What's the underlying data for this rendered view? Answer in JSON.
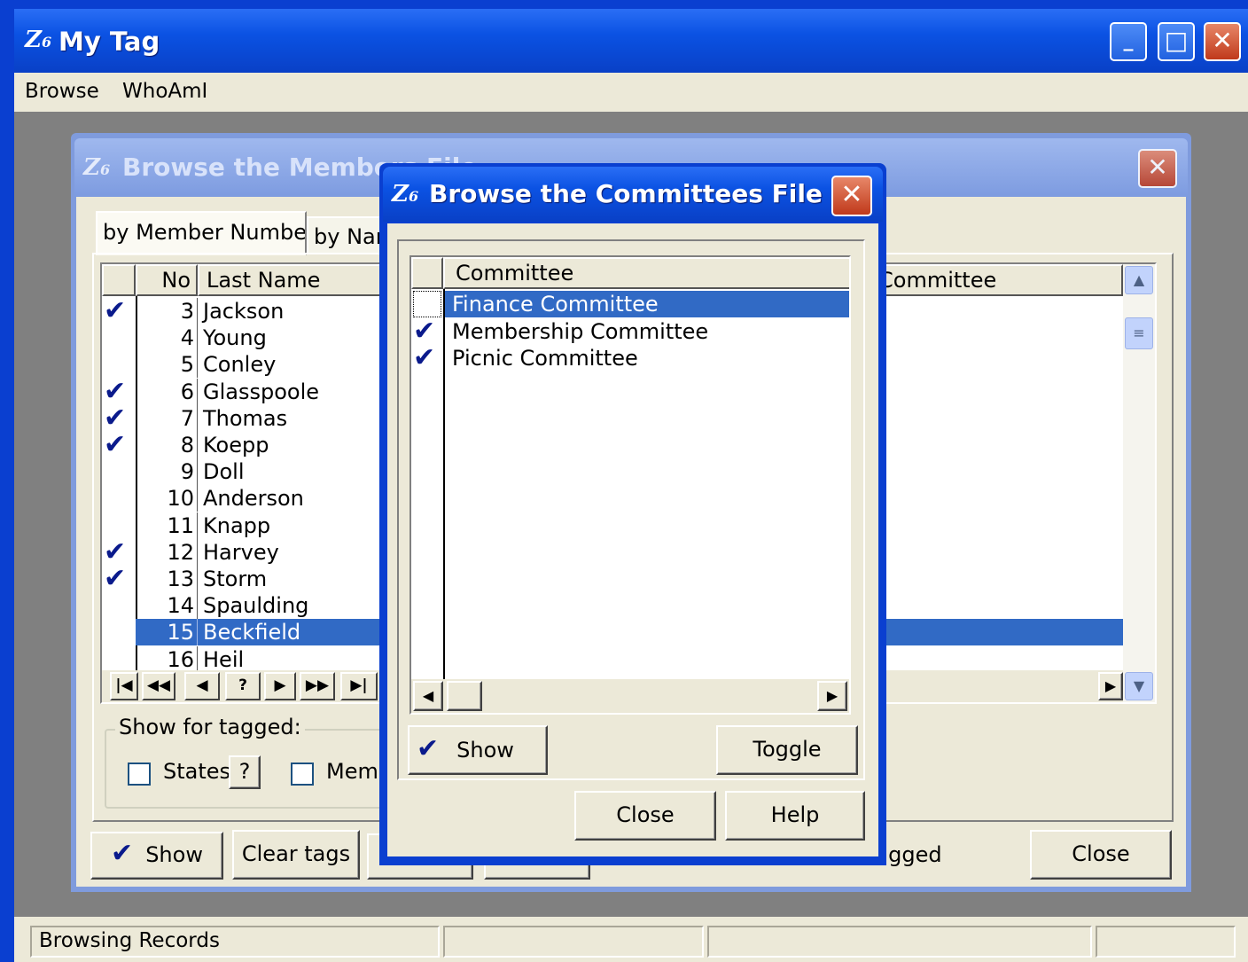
{
  "main_window": {
    "title": "My Tag",
    "logo": "Z",
    "logo_sub": "6",
    "controls": {
      "minimize": "_",
      "maximize": "□",
      "close": "✕"
    },
    "menu": [
      "Browse",
      "WhoAmI"
    ]
  },
  "members_dialog": {
    "title": "Browse the Members File",
    "close_glyph": "✕",
    "tabs": [
      "by Member Number",
      "by Name"
    ],
    "columns": {
      "no": "No",
      "last_name": "Last Name",
      "committee": "Committee"
    },
    "rows": [
      {
        "no": "3",
        "last_name": "Jackson",
        "tagged": true
      },
      {
        "no": "4",
        "last_name": "Young",
        "tagged": false
      },
      {
        "no": "5",
        "last_name": "Conley",
        "tagged": false
      },
      {
        "no": "6",
        "last_name": "Glasspoole",
        "tagged": true
      },
      {
        "no": "7",
        "last_name": "Thomas",
        "tagged": true
      },
      {
        "no": "8",
        "last_name": "Koepp",
        "tagged": true
      },
      {
        "no": "9",
        "last_name": "Doll",
        "tagged": false
      },
      {
        "no": "10",
        "last_name": "Anderson",
        "tagged": false
      },
      {
        "no": "11",
        "last_name": "Knapp",
        "tagged": false
      },
      {
        "no": "12",
        "last_name": "Harvey",
        "tagged": true
      },
      {
        "no": "13",
        "last_name": "Storm",
        "tagged": true
      },
      {
        "no": "14",
        "last_name": "Spaulding",
        "tagged": false
      },
      {
        "no": "15",
        "last_name": "Beckfield",
        "tagged": false,
        "selected": true
      },
      {
        "no": "16",
        "last_name": "Heil",
        "tagged": false
      }
    ],
    "nav_buttons": [
      "|◀",
      "◀◀",
      "◀",
      "?",
      "▶",
      "▶▶",
      "▶|"
    ],
    "show_for_tagged": {
      "label": "Show for tagged:",
      "states_label": "States",
      "states_help": "?",
      "members_label": "Memb"
    },
    "buttons": {
      "show": "Show",
      "clear_tags": "Clear tags",
      "close": "Close"
    },
    "tagged_text": "tagged",
    "check_glyph": "✔"
  },
  "committees_dialog": {
    "title": "Browse the Committees File",
    "close_glyph": "✕",
    "column": "Committee",
    "rows": [
      {
        "name": "Finance Committee",
        "tagged": false,
        "selected": true
      },
      {
        "name": "Membership Committee",
        "tagged": true
      },
      {
        "name": "Picnic Committee",
        "tagged": true
      }
    ],
    "buttons": {
      "show": "Show",
      "toggle": "Toggle",
      "close": "Close",
      "help": "Help"
    }
  },
  "statusbar": {
    "panels": [
      "Browsing Records",
      "",
      "",
      ""
    ]
  },
  "colors": {
    "selection": "#316ac5",
    "title_blue": "#0b52e3",
    "check": "#0a1a8c",
    "face": "#ece9d8"
  }
}
